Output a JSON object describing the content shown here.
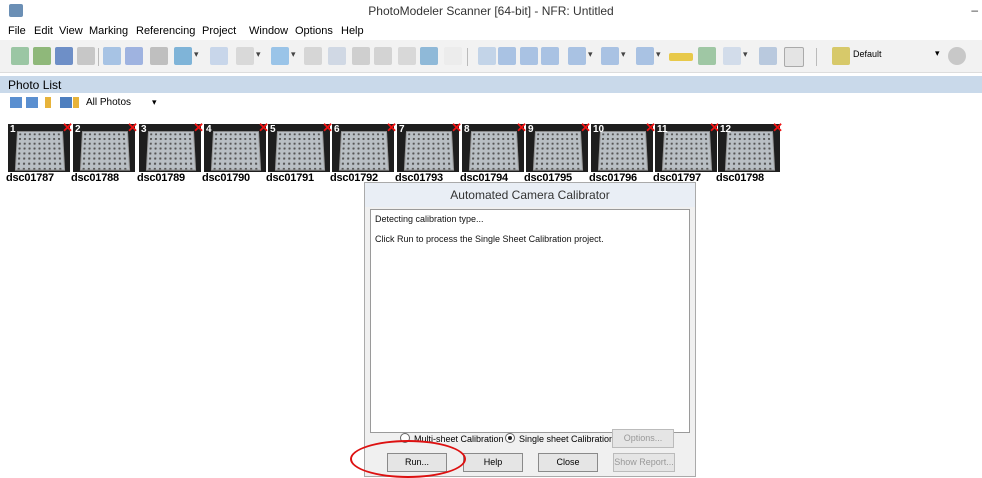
{
  "window": {
    "title": "PhotoModeler Scanner [64-bit] - NFR: Untitled",
    "minimize": "–"
  },
  "menu": [
    "File",
    "Edit",
    "View",
    "Marking",
    "Referencing",
    "Project",
    "Window",
    "Options",
    "Help"
  ],
  "toolbar": {
    "preset": "Default"
  },
  "photo_list": {
    "header": "Photo List",
    "filter": "All Photos",
    "photos": [
      {
        "num": "1",
        "name": "dsc01787"
      },
      {
        "num": "2",
        "name": "dsc01788"
      },
      {
        "num": "3",
        "name": "dsc01789"
      },
      {
        "num": "4",
        "name": "dsc01790"
      },
      {
        "num": "5",
        "name": "dsc01791"
      },
      {
        "num": "6",
        "name": "dsc01792"
      },
      {
        "num": "7",
        "name": "dsc01793"
      },
      {
        "num": "8",
        "name": "dsc01794"
      },
      {
        "num": "9",
        "name": "dsc01795"
      },
      {
        "num": "10",
        "name": "dsc01796"
      },
      {
        "num": "11",
        "name": "dsc01797"
      },
      {
        "num": "12",
        "name": "dsc01798"
      }
    ]
  },
  "dialog": {
    "title": "Automated Camera Calibrator",
    "log": [
      "Detecting calibration type...",
      "Click Run to process the Single Sheet Calibration project."
    ],
    "radio_multi": "Multi-sheet Calibration",
    "radio_single": "Single sheet Calibration",
    "options": "Options...",
    "run": "Run...",
    "help": "Help",
    "close": "Close",
    "show_report": "Show Report..."
  }
}
